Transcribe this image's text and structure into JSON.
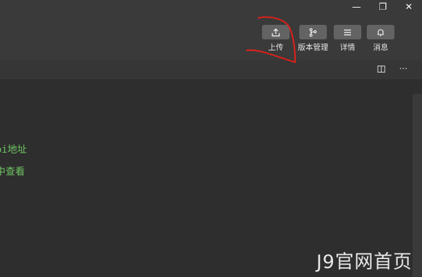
{
  "window_controls": {
    "minimize": "—",
    "restore": "❐",
    "close": "✕"
  },
  "toolbar": {
    "buttons": [
      {
        "label": "上传",
        "icon": "upload-icon"
      },
      {
        "label": "版本管理",
        "icon": "branch-icon"
      },
      {
        "label": "详情",
        "icon": "list-icon"
      },
      {
        "label": "消息",
        "icon": "bell-icon"
      }
    ]
  },
  "subbar": {
    "split_icon": "split-view-icon",
    "more_label": "···"
  },
  "editor": {
    "lines": [
      "pi地址",
      "中查看"
    ]
  },
  "watermark": "J9官网首页",
  "colors": {
    "code_text": "#6ec463",
    "annotation": "#d9211c"
  }
}
